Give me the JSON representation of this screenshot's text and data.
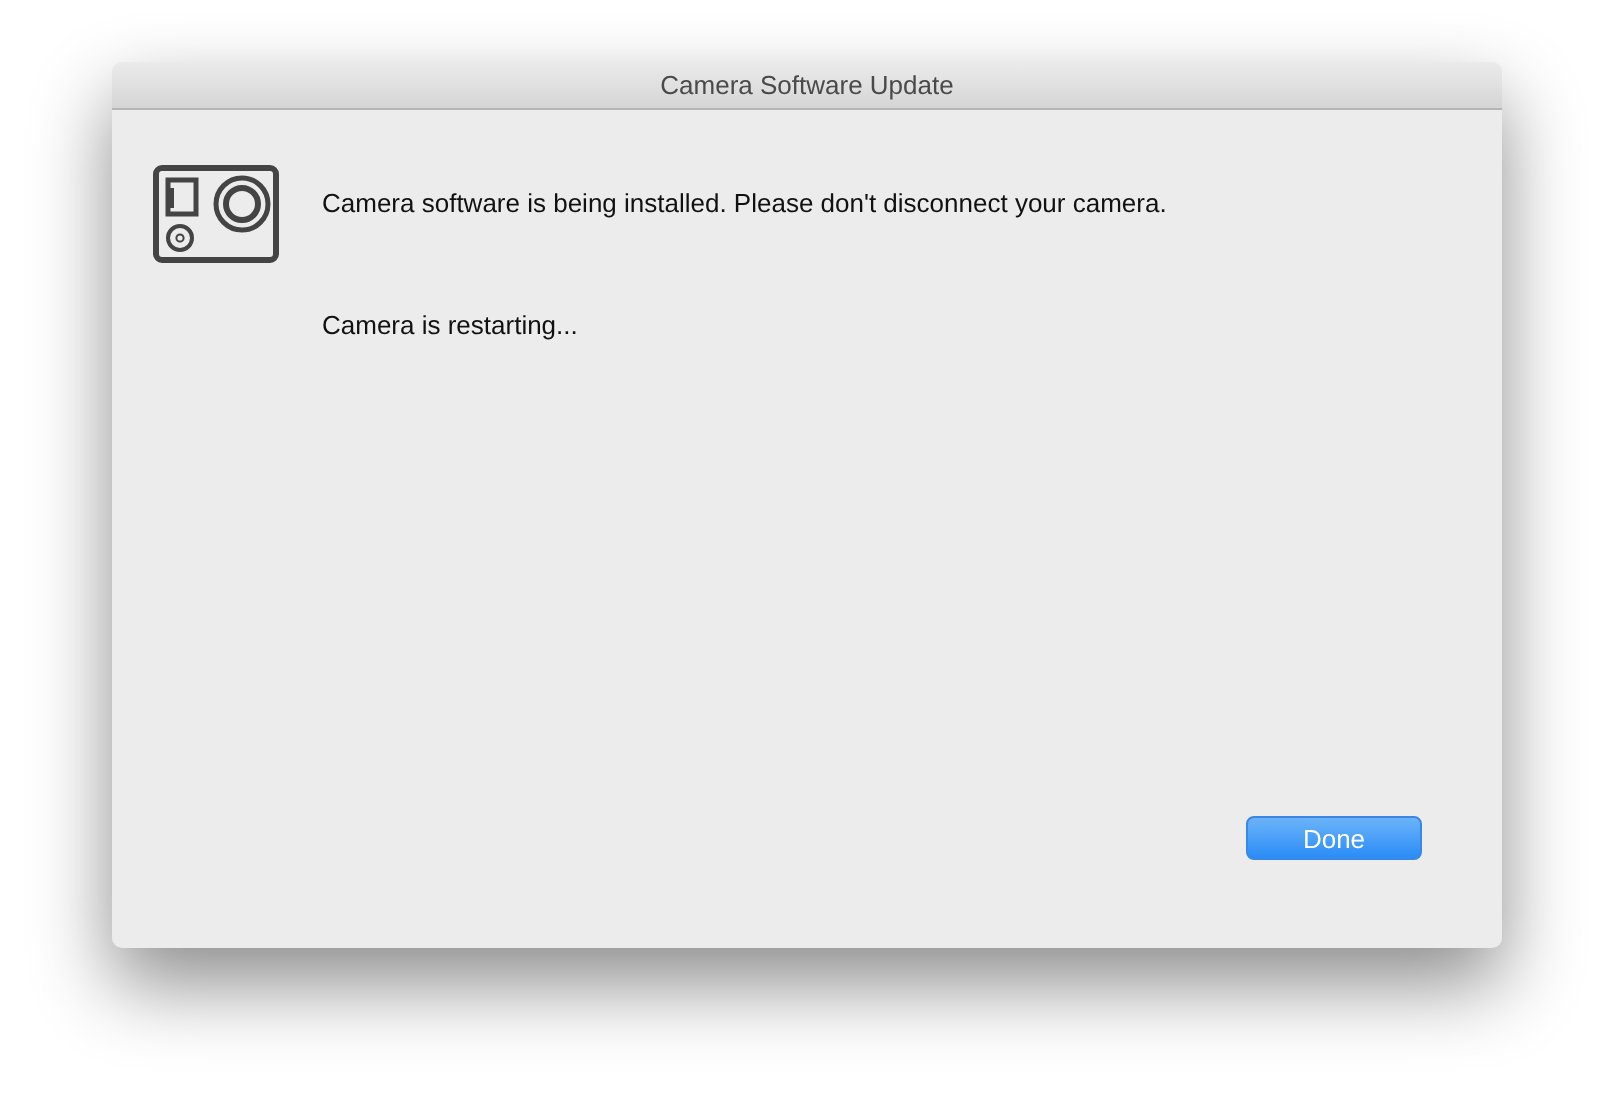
{
  "window": {
    "title": "Camera Software Update"
  },
  "message": "Camera software is being installed. Please don't disconnect your camera.",
  "status": "Camera is restarting...",
  "buttons": [
    {
      "label": "Done",
      "default": true
    }
  ]
}
